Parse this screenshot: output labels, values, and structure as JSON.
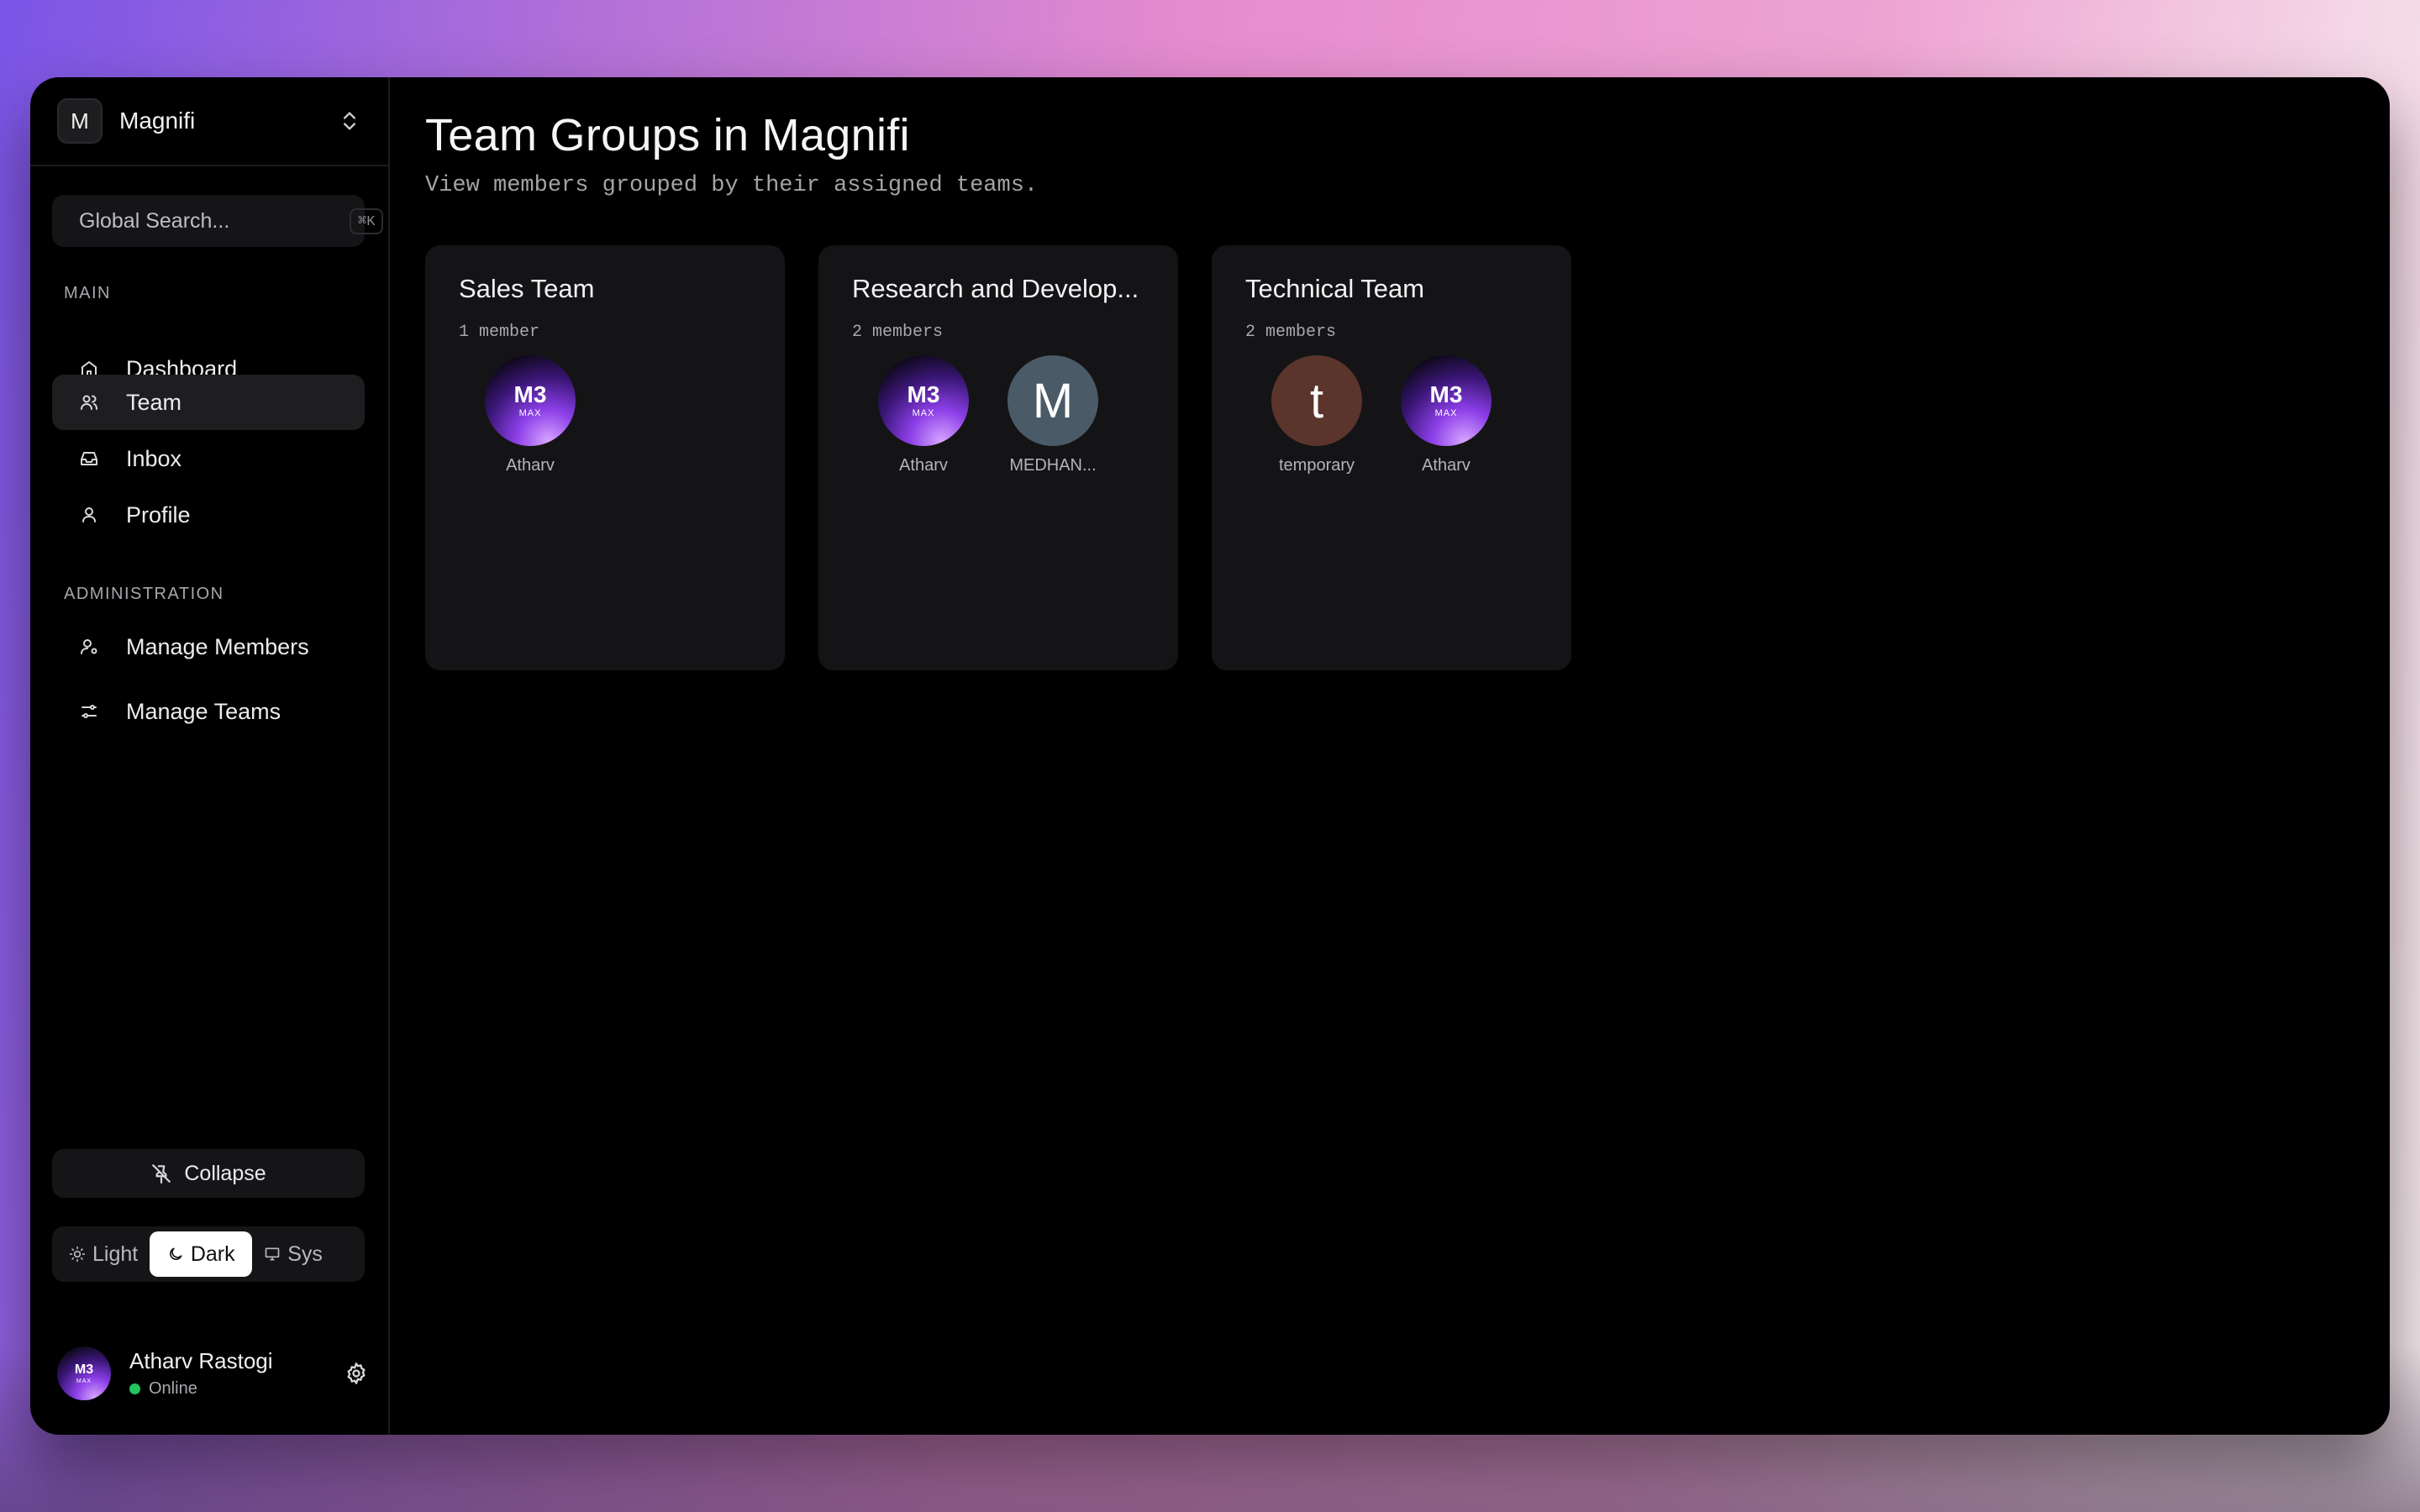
{
  "workspace": {
    "initial": "M",
    "name": "Magnifi"
  },
  "search": {
    "placeholder": "Global Search...",
    "shortcut": "⌘K"
  },
  "sections": {
    "main": "MAIN",
    "admin": "ADMINISTRATION"
  },
  "nav": {
    "dashboard": "Dashboard",
    "team": "Team",
    "inbox": "Inbox",
    "profile": "Profile",
    "manage_members": "Manage Members",
    "manage_teams": "Manage Teams"
  },
  "collapse_label": "Collapse",
  "theme": {
    "light": "Light",
    "dark": "Dark",
    "sys": "Sys",
    "selected": "Dark"
  },
  "user": {
    "name": "Atharv Rastogi",
    "status": "Online",
    "status_color": "#22c55e"
  },
  "page": {
    "title": "Team Groups in Magnifi",
    "subtitle": "View members grouped by their assigned teams."
  },
  "avatar_chip": {
    "top": "M3",
    "bottom": "MAX",
    "logo": "apple-logo"
  },
  "teams": [
    {
      "name": "Sales Team",
      "count": "1 member",
      "members": [
        {
          "name": "Atharv",
          "avatar": "chip"
        }
      ]
    },
    {
      "name": "Research and Develop...",
      "count": "2 members",
      "members": [
        {
          "name": "Atharv",
          "avatar": "chip"
        },
        {
          "name": "MEDHAN...",
          "avatar": "letter",
          "letter": "M",
          "color": "#4a5a66"
        }
      ]
    },
    {
      "name": "Technical Team",
      "count": "2 members",
      "members": [
        {
          "name": "temporary",
          "avatar": "letter",
          "letter": "t",
          "color": "#5b342c"
        },
        {
          "name": "Atharv",
          "avatar": "chip"
        }
      ]
    }
  ]
}
